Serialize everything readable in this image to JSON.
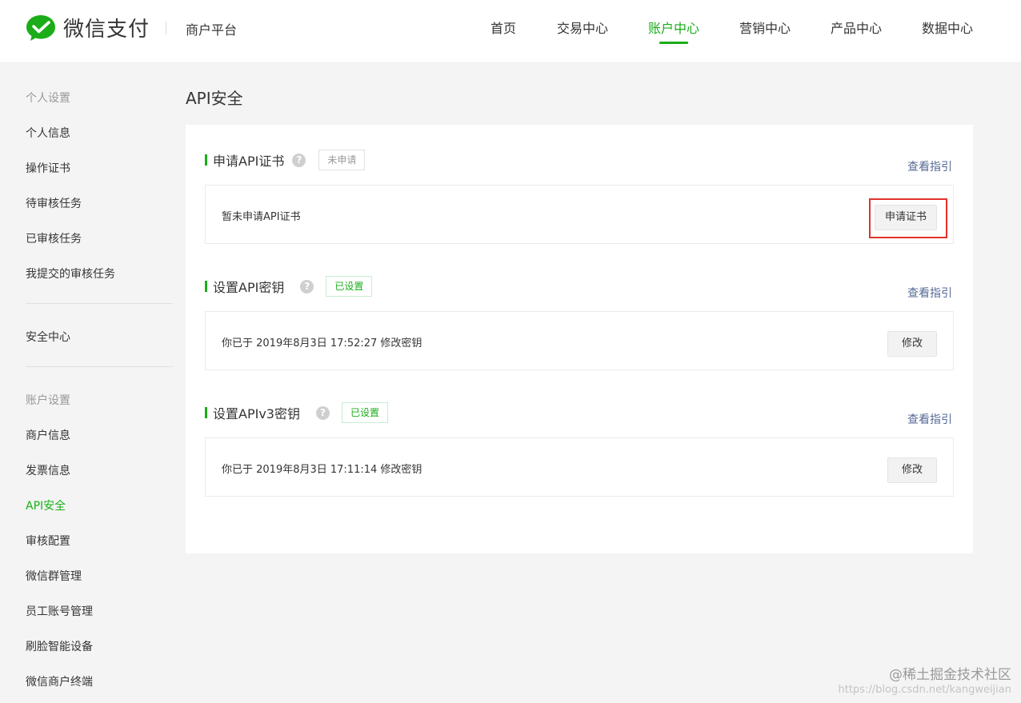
{
  "brand": {
    "name": "微信支付",
    "platform": "商户平台",
    "accent": "#1aad19"
  },
  "nav": {
    "items": [
      {
        "label": "首页"
      },
      {
        "label": "交易中心"
      },
      {
        "label": "账户中心",
        "active": true
      },
      {
        "label": "营销中心"
      },
      {
        "label": "产品中心"
      },
      {
        "label": "数据中心"
      }
    ]
  },
  "sidebar": {
    "group1": "个人设置",
    "personal": [
      "个人信息",
      "操作证书",
      "待审核任务",
      "已审核任务",
      "我提交的审核任务"
    ],
    "security_center": "安全中心",
    "group2": "账户设置",
    "account": [
      "商户信息",
      "发票信息",
      "API安全",
      "审核配置",
      "微信群管理",
      "员工账号管理",
      "刷脸智能设备",
      "微信商户终端"
    ],
    "active": "API安全"
  },
  "page": {
    "title": "API安全"
  },
  "sections": [
    {
      "title": "申请API证书",
      "help": "?",
      "badge": "未申请",
      "guide": "查看指引",
      "text": "暂未申请API证书",
      "button": "申请证书"
    },
    {
      "title": "设置API密钥",
      "help": "?",
      "badge": "已设置",
      "guide": "查看指引",
      "text": "你已于 2019年8月3日 17:52:27 修改密钥",
      "button": "修改"
    },
    {
      "title": "设置APIv3密钥",
      "help": "?",
      "badge": "已设置",
      "guide": "查看指引",
      "text": "你已于 2019年8月3日 17:11:14 修改密钥",
      "button": "修改"
    }
  ],
  "watermark": {
    "line1": "@稀土掘金技术社区",
    "line2": "https://blog.csdn.net/kangweijian"
  }
}
